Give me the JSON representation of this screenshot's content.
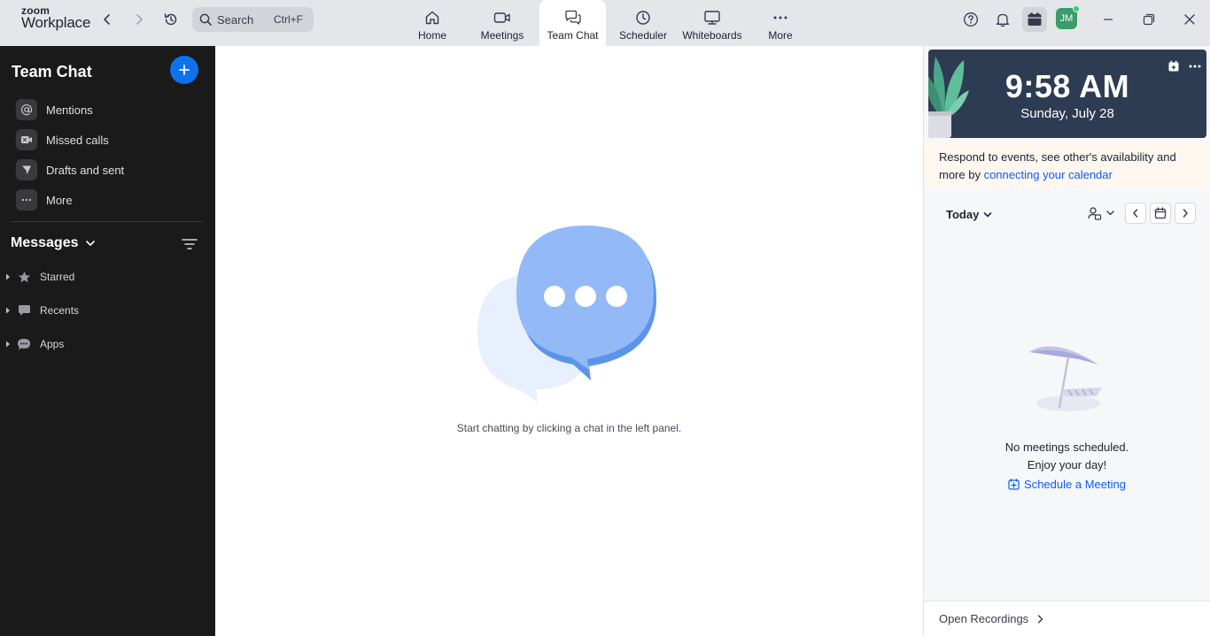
{
  "app": {
    "logo_top": "zoom",
    "logo_bottom": "Workplace"
  },
  "search": {
    "label": "Search",
    "shortcut": "Ctrl+F"
  },
  "nav": {
    "tabs": [
      {
        "label": "Home",
        "icon": "home-icon"
      },
      {
        "label": "Meetings",
        "icon": "video-camera-icon"
      },
      {
        "label": "Team Chat",
        "icon": "chat-bubbles-icon",
        "active": true
      },
      {
        "label": "Scheduler",
        "icon": "clock-icon"
      },
      {
        "label": "Whiteboards",
        "icon": "whiteboard-icon"
      },
      {
        "label": "More",
        "icon": "more-dots-icon"
      }
    ]
  },
  "user": {
    "initials": "JM",
    "status": "online"
  },
  "sidebar": {
    "title": "Team Chat",
    "items": [
      {
        "label": "Mentions",
        "icon": "at-sign-icon"
      },
      {
        "label": "Missed calls",
        "icon": "missed-video-icon"
      },
      {
        "label": "Drafts and sent",
        "icon": "send-icon"
      },
      {
        "label": "More",
        "icon": "more-dots-icon"
      }
    ],
    "messages_header": "Messages",
    "tree": [
      {
        "label": "Starred",
        "icon": "star-icon"
      },
      {
        "label": "Recents",
        "icon": "chat-bubble-icon"
      },
      {
        "label": "Apps",
        "icon": "app-bubble-icon"
      }
    ]
  },
  "main": {
    "empty_text": "Start chatting by clicking a chat in the left panel."
  },
  "right_panel": {
    "time": "9:58 AM",
    "date": "Sunday, July 28",
    "notice_text": "Respond to events, see other's availability and more by ",
    "notice_link": "connecting your calendar",
    "day_selector": "Today",
    "empty_line1": "No meetings scheduled.",
    "empty_line2": "Enjoy your day!",
    "schedule_link": "Schedule a Meeting",
    "footer_link": "Open Recordings"
  },
  "colors": {
    "accent": "#0e72ed",
    "link": "#0b5cff",
    "sidebar_bg": "#1a1a1a",
    "topbar_bg": "#e5e6ea",
    "avatar_bg": "#3a9c6c",
    "clock_card_bg": "#2d3c52"
  }
}
